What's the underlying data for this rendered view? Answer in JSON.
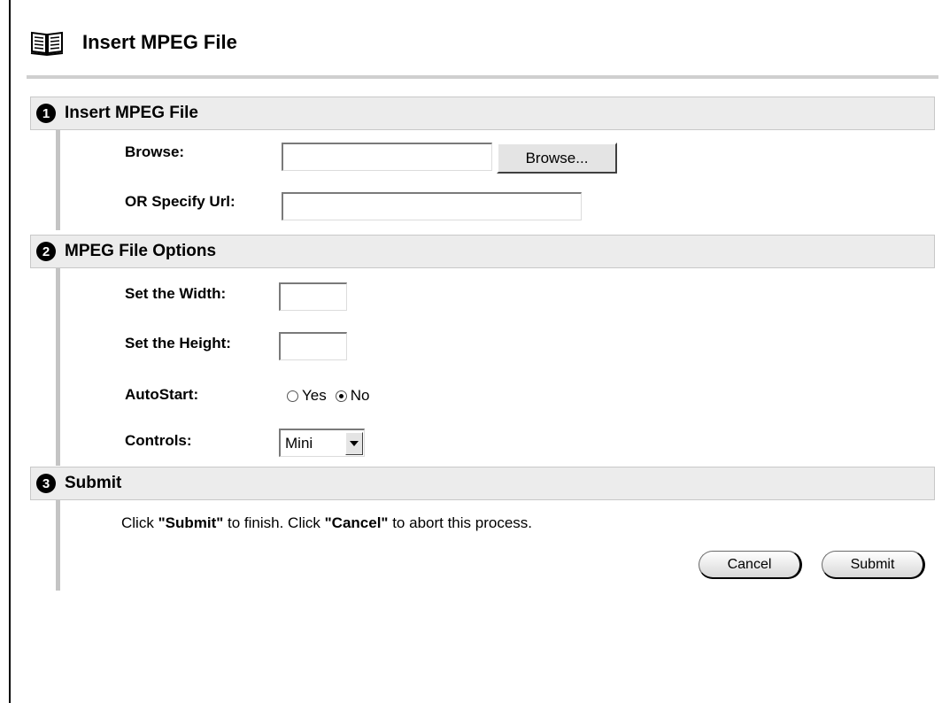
{
  "page": {
    "title": "Insert MPEG File"
  },
  "steps": [
    {
      "number": "1",
      "title": "Insert MPEG File"
    },
    {
      "number": "2",
      "title": "MPEG File Options"
    },
    {
      "number": "3",
      "title": "Submit"
    }
  ],
  "insert_file": {
    "browse_label": "Browse:",
    "browse_value": "",
    "browse_button": "Browse...",
    "url_label": "OR Specify Url:",
    "url_value": ""
  },
  "options": {
    "width_label": "Set the Width:",
    "width_value": "",
    "height_label": "Set the Height:",
    "height_value": "",
    "autostart_label": "AutoStart:",
    "autostart_options": [
      "Yes",
      "No"
    ],
    "autostart_selected": "No",
    "controls_label": "Controls:",
    "controls_value": "Mini"
  },
  "submit": {
    "instr_click_1": "Click ",
    "instr_submit": "\"Submit\"",
    "instr_middle": " to finish. Click ",
    "instr_cancel": "\"Cancel\"",
    "instr_end": " to abort this process.",
    "cancel_label": "Cancel",
    "submit_label": "Submit"
  }
}
